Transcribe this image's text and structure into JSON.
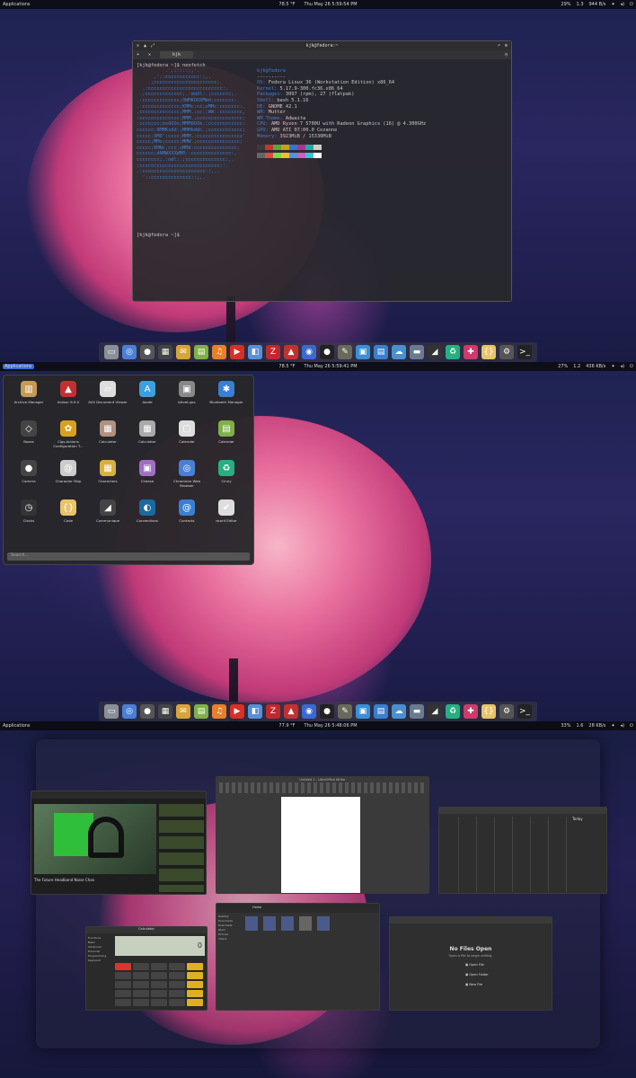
{
  "topbar": {
    "applications_label": "Applications",
    "temp": "78.5 °F",
    "temp2": "77.9 °F",
    "datetime1": "Thu May 26   5:59:54 PM",
    "datetime2": "Thu May 26   5:59:41 PM",
    "datetime3": "Thu May 26   5:48:06 PM",
    "cpu1": "29%",
    "mem1": "1.3",
    "net1": "944 B/s",
    "cpu2": "27%",
    "mem2": "1.2",
    "net2": "436 KB/s",
    "cpu3": "33%",
    "mem3": "1.6",
    "net3": "28 KB/s"
  },
  "terminal": {
    "title": "kjk@fedora:~",
    "tab_label": "kjk",
    "prompt1": "[kjk@fedora ~]$ neofetch",
    "prompt2": "[kjk@fedora ~]$",
    "user_host": "kjk@fedora",
    "separator": "----------",
    "os_key": "OS:",
    "os_val": " Fedora Linux 36 (Workstation Edition) x86_64",
    "kernel_key": "Kernel:",
    "kernel_val": " 5.17.9-300.fc36.x86_64",
    "packages_key": "Packages:",
    "packages_val": " 3097 (rpm), 27 (flatpak)",
    "shell_key": "Shell:",
    "shell_val": " bash 5.1.16",
    "de_key": "DE:",
    "de_val": " GNOME 42.1",
    "wm_key": "WM:",
    "wm_val": " Mutter",
    "wmtheme_key": "WM Theme:",
    "wmtheme_val": " Adwaita",
    "cpu_key": "CPU:",
    "cpu_val": " AMD Ryzen 7 5700U with Radeon Graphics (16) @ 4.300GHz",
    "gpu_key": "GPU:",
    "gpu_val": " AMD ATI 07:00.0 Cezanne",
    "memory_key": "Memory:",
    "memory_val": " 3923MiB / 15330MiB",
    "swatches_top": [
      "#3a3a3a",
      "#cc3333",
      "#55aa33",
      "#c8a020",
      "#3377cc",
      "#aa3399",
      "#22aaaa",
      "#cccccc"
    ],
    "swatches_bot": [
      "#666666",
      "#ee4444",
      "#77dd44",
      "#eec030",
      "#4499ee",
      "#dd55cc",
      "#33cccc",
      "#ffffff"
    ]
  },
  "dock_icons": [
    {
      "name": "files-icon",
      "glyph": "▭",
      "color": "#8a8f99"
    },
    {
      "name": "chromium-icon",
      "glyph": "◎",
      "color": "#4a7fd6"
    },
    {
      "name": "camera-icon",
      "glyph": "●",
      "color": "#555"
    },
    {
      "name": "calculator-icon",
      "glyph": "▦",
      "color": "#444"
    },
    {
      "name": "mail-icon",
      "glyph": "✉",
      "color": "#d8a43a"
    },
    {
      "name": "calendar-icon",
      "glyph": "▤",
      "color": "#7fb04a"
    },
    {
      "name": "music-icon",
      "glyph": "♫",
      "color": "#e87f2a"
    },
    {
      "name": "youtube-icon",
      "glyph": "▶",
      "color": "#d93025"
    },
    {
      "name": "software-icon",
      "glyph": "◧",
      "color": "#5a8fd6"
    },
    {
      "name": "filezilla-icon",
      "glyph": "Z",
      "color": "#c0282d"
    },
    {
      "name": "ardour-icon",
      "glyph": "▲",
      "color": "#c43030"
    },
    {
      "name": "blender-icon",
      "glyph": "◉",
      "color": "#3a6ad0"
    },
    {
      "name": "obs-icon",
      "glyph": "●",
      "color": "#222"
    },
    {
      "name": "gimp-icon",
      "glyph": "✎",
      "color": "#6a6a5a"
    },
    {
      "name": "screenshot-icon",
      "glyph": "▣",
      "color": "#3a8fd6"
    },
    {
      "name": "document-icon",
      "glyph": "▤",
      "color": "#3a7fd0"
    },
    {
      "name": "cloud-icon",
      "glyph": "☁",
      "color": "#4a90d0"
    },
    {
      "name": "drive-icon",
      "glyph": "▬",
      "color": "#6a7a90"
    },
    {
      "name": "rss-icon",
      "glyph": "◢",
      "color": "#333"
    },
    {
      "name": "games-icon",
      "glyph": "♻",
      "color": "#26b080"
    },
    {
      "name": "extensions-icon",
      "glyph": "✚",
      "color": "#cf3a6a"
    },
    {
      "name": "code-icon",
      "glyph": "{}",
      "color": "#e8c46a"
    },
    {
      "name": "settings-icon",
      "glyph": "⚙",
      "color": "#555"
    },
    {
      "name": "terminal-icon",
      "glyph": ">_",
      "color": "#222"
    }
  ],
  "app_grid": {
    "search_placeholder": "Search...",
    "apps": [
      {
        "label": "Archive Manager",
        "glyph": "▥",
        "color": "#c59a55",
        "name": "archive-manager-icon"
      },
      {
        "label": "Ardour 6.9.0",
        "glyph": "▲",
        "color": "#c43030",
        "name": "ardour-icon"
      },
      {
        "label": "AVX Document Viewer",
        "glyph": "▱",
        "color": "#ddd",
        "name": "document-viewer-icon"
      },
      {
        "label": "Avote",
        "glyph": "A",
        "color": "#3aa0e0",
        "name": "avote-icon"
      },
      {
        "label": "bitvet-gss",
        "glyph": "▣",
        "color": "#888",
        "name": "bitvet-icon"
      },
      {
        "label": "Bluetooth Manager",
        "glyph": "✱",
        "color": "#3a7fd0",
        "name": "bluetooth-icon"
      },
      {
        "label": "Boxes",
        "glyph": "◇",
        "color": "#444",
        "name": "boxes-icon"
      },
      {
        "label": "Cigs-Actions Configuration T...",
        "glyph": "✿",
        "color": "#d9a020",
        "name": "cigs-icon"
      },
      {
        "label": "Calculator",
        "glyph": "▦",
        "color": "#b09080",
        "name": "calculator-icon"
      },
      {
        "label": "Calculator",
        "glyph": "▦",
        "color": "#aaa",
        "name": "calculator2-icon"
      },
      {
        "label": "Calendar",
        "glyph": "▢",
        "color": "#ddd",
        "name": "calendar-icon"
      },
      {
        "label": "Calendar",
        "glyph": "▤",
        "color": "#7fb04a",
        "name": "calendar2-icon"
      },
      {
        "label": "Camera",
        "glyph": "●",
        "color": "#444",
        "name": "camera-icon"
      },
      {
        "label": "Character Map",
        "glyph": "@",
        "color": "#ccc",
        "name": "character-map-icon"
      },
      {
        "label": "Characters",
        "glyph": "▦",
        "color": "#d8b040",
        "name": "characters-icon"
      },
      {
        "label": "Cheese",
        "glyph": "▣",
        "color": "#a070c0",
        "name": "cheese-icon"
      },
      {
        "label": "Chromium Web Browser",
        "glyph": "◎",
        "color": "#4a7fd6",
        "name": "chromium-icon"
      },
      {
        "label": "Cinny",
        "glyph": "♻",
        "color": "#26b080",
        "name": "cinny-icon"
      },
      {
        "label": "Clocks",
        "glyph": "◷",
        "color": "#333",
        "name": "clocks-icon"
      },
      {
        "label": "Code",
        "glyph": "{}",
        "color": "#e8c46a",
        "name": "code-icon"
      },
      {
        "label": "Communique",
        "glyph": "◢",
        "color": "#444",
        "name": "communique-icon"
      },
      {
        "label": "Connections",
        "glyph": "◐",
        "color": "#1a6aa0",
        "name": "connections-icon"
      },
      {
        "label": "Contacts",
        "glyph": "@",
        "color": "#3a7fd0",
        "name": "contacts-icon"
      },
      {
        "label": "dconf Editor",
        "glyph": "✔",
        "color": "#ddd",
        "name": "dconf-editor-icon"
      }
    ]
  },
  "overview": {
    "video_title": "The Future Headband Noise Chan",
    "libreoffice_title": "Untitled 1 - LibreOffice Writer",
    "calendar_today": "Today",
    "calc_title": "Calculator",
    "calc_display": "0",
    "calc_sidebar": [
      "Functions",
      "Basic",
      "Advanced",
      "Financial",
      "Programming",
      "Keyboard"
    ],
    "files_title": "Home",
    "files_items": [
      "Desktop",
      "Documents",
      "Downloads",
      "Music",
      "Pictures",
      "Videos"
    ],
    "editor_title": "No Files Open",
    "editor_subtitle": "Open a file to begin editing.",
    "editor_actions": [
      "Open File",
      "Open Folder",
      "New File"
    ]
  }
}
